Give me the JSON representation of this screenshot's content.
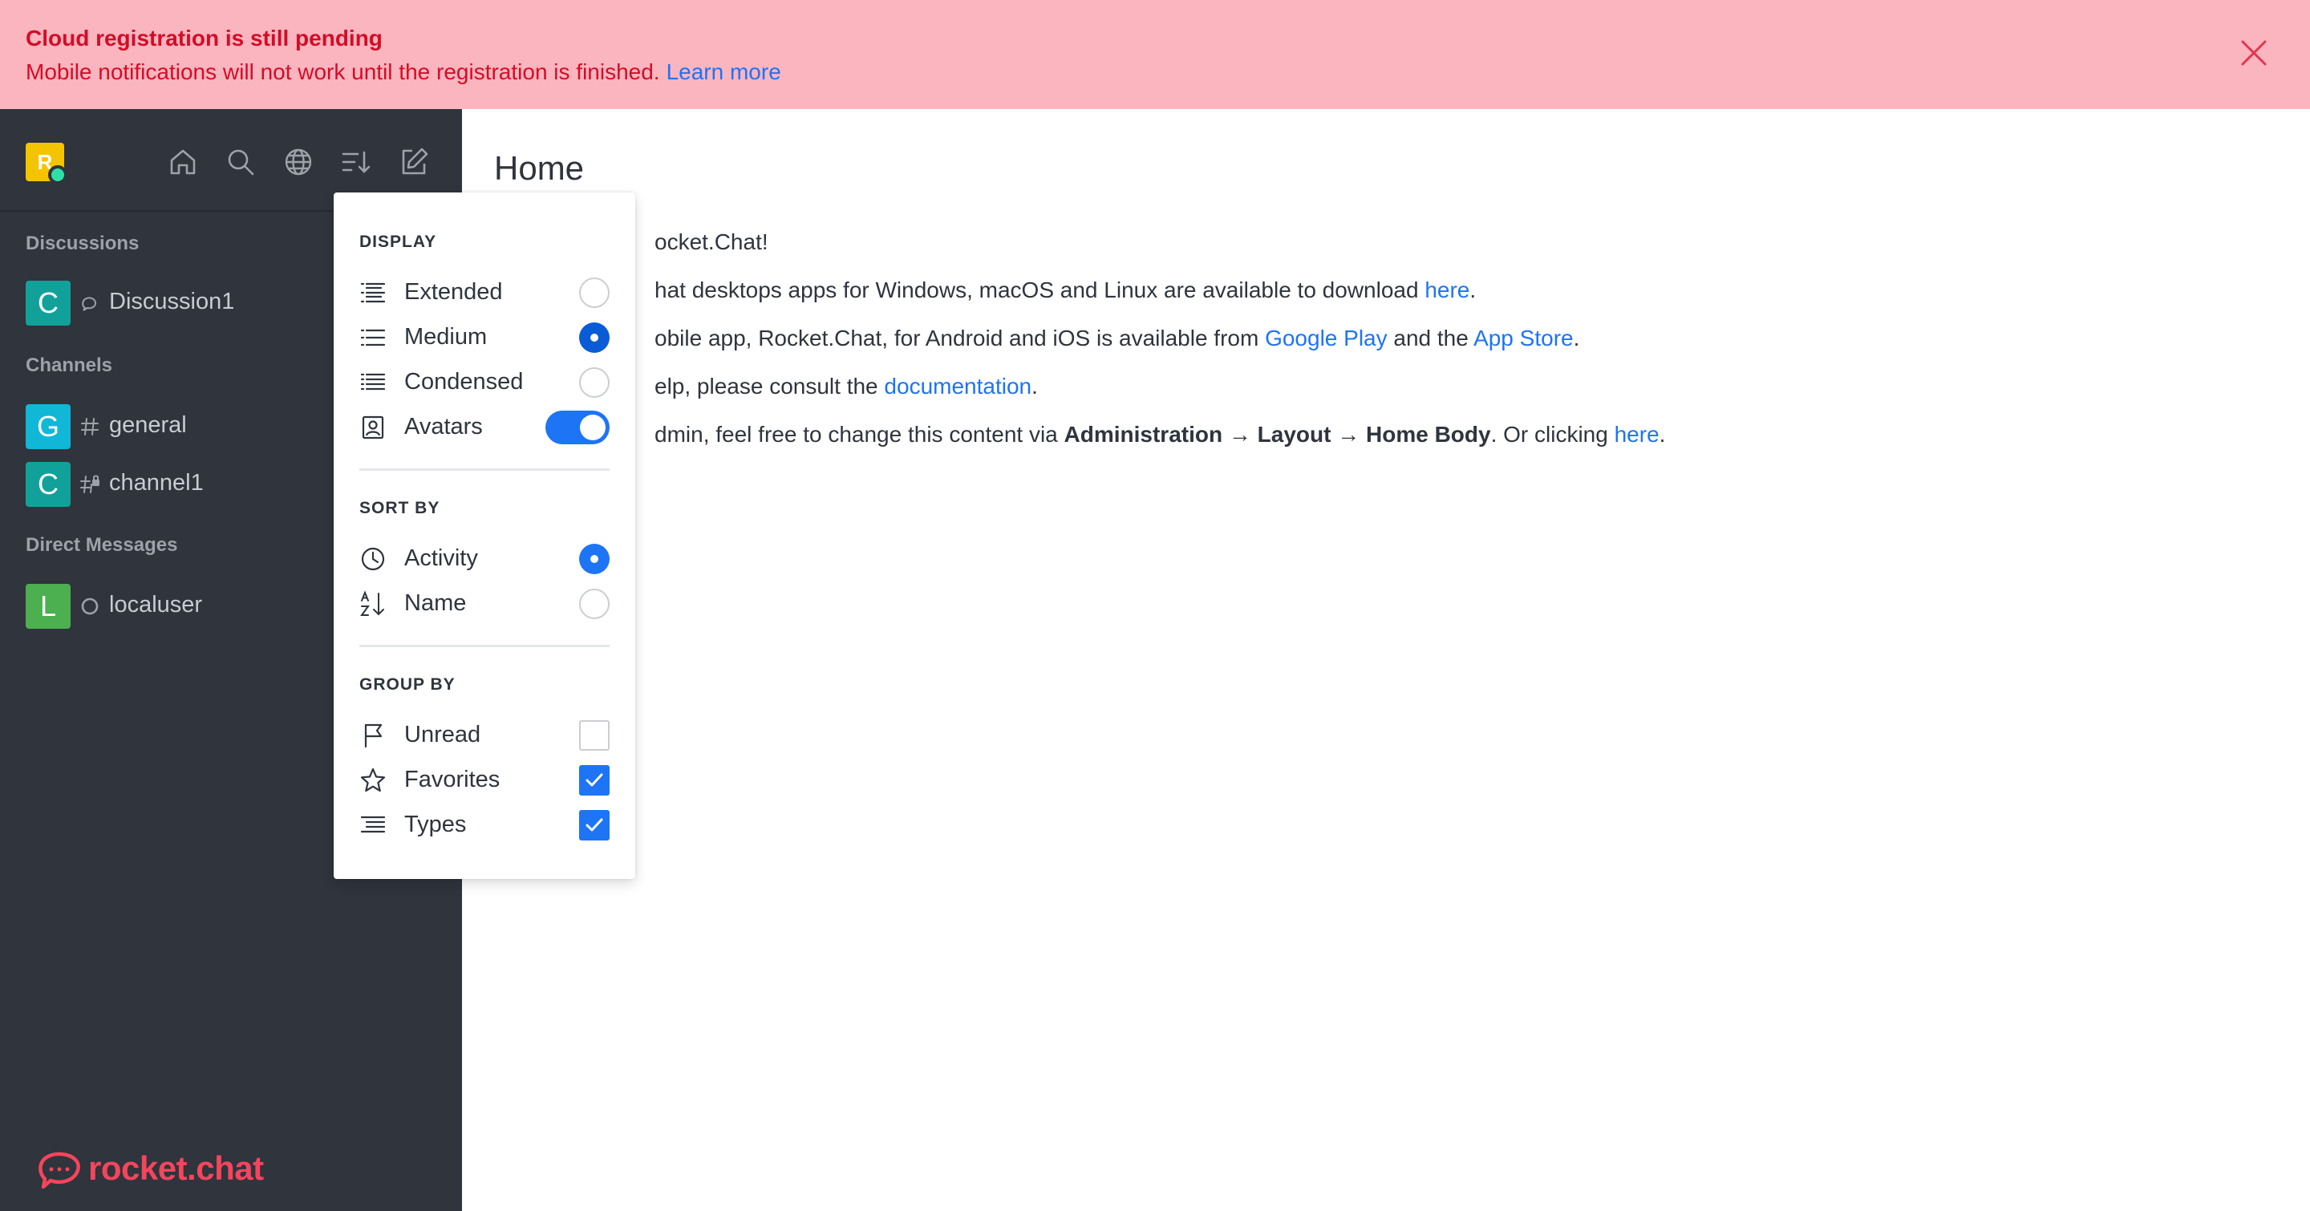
{
  "banner": {
    "title": "Cloud registration is still pending",
    "text": "Mobile notifications will not work until the registration is finished.",
    "link": "Learn more"
  },
  "sidebar": {
    "user_initial": "R",
    "sections": {
      "discussions": "Discussions",
      "channels": "Channels",
      "direct": "Direct Messages"
    },
    "rooms": [
      {
        "initial": "C",
        "label": "Discussion1",
        "color": "#12a19a",
        "icon": "discussion-icon"
      },
      {
        "initial": "G",
        "label": "general",
        "color": "#10b7d6",
        "icon": "hashtag-icon"
      },
      {
        "initial": "C",
        "label": "channel1",
        "color": "#12a19a",
        "icon": "hashtag-lock-icon"
      },
      {
        "initial": "L",
        "label": "localuser",
        "color": "#4caf50",
        "icon": "status-offline-icon"
      }
    ],
    "brand": "rocket.chat"
  },
  "menu": {
    "display_title": "DISPLAY",
    "extended": "Extended",
    "medium": "Medium",
    "condensed": "Condensed",
    "avatars": "Avatars",
    "sort_title": "SORT BY",
    "activity": "Activity",
    "name": "Name",
    "group_title": "GROUP BY",
    "unread": "Unread",
    "favorites": "Favorites",
    "types": "Types"
  },
  "main": {
    "title": "Home",
    "line1": "ocket.Chat!",
    "line2_pre": "hat desktops apps for Windows, macOS and Linux are available to download ",
    "line2_link": "here",
    "line2_post": ".",
    "line3_pre": "obile app, Rocket.Chat, for Android and iOS is available from ",
    "line3_link1": "Google Play",
    "line3_mid": " and the ",
    "line3_link2": "App Store",
    "line3_post": ".",
    "line4_pre": "elp, please consult the ",
    "line4_link": "documentation",
    "line4_post": ".",
    "line5_pre": "dmin, feel free to change this content via ",
    "line5_b1": "Administration",
    "line5_arrow1": " → ",
    "line5_b2": "Layout",
    "line5_arrow2": " → ",
    "line5_b3": "Home Body",
    "line5_mid": ". Or clicking ",
    "line5_link": "here",
    "line5_post": "."
  },
  "colors": {
    "banner_bg": "#fbb5bf",
    "banner_text": "#d40c26",
    "sidebar_bg": "#2f343d",
    "accent": "#1d74f5",
    "brand": "#f5455c"
  }
}
